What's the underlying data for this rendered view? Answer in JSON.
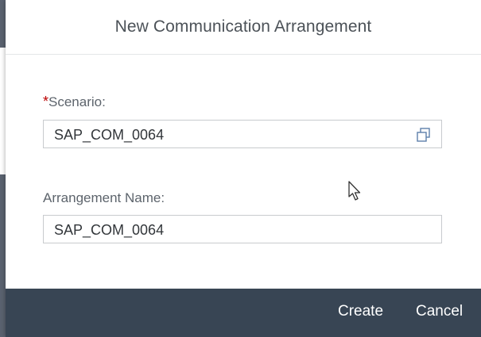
{
  "dialog": {
    "title": "New Communication Arrangement"
  },
  "form": {
    "scenario": {
      "required_marker": "*",
      "label": "Scenario:",
      "value": "SAP_COM_0064",
      "value_help_icon": "value-help-icon"
    },
    "arrangement_name": {
      "label": "Arrangement Name:",
      "value": "SAP_COM_0064"
    }
  },
  "footer": {
    "create_label": "Create",
    "cancel_label": "Cancel"
  },
  "colors": {
    "footer_background": "#384554",
    "required_star": "#bb0000",
    "input_border": "#c8cbce"
  }
}
